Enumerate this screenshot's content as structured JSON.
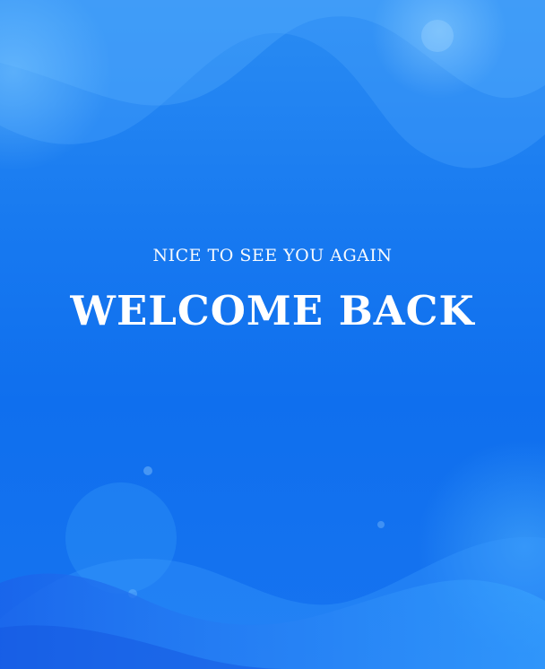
{
  "screen": {
    "subtitle": "NICE TO SEE YOU AGAIN",
    "title": "WELCOME BACK"
  },
  "colors": {
    "background": "#1779f0",
    "text": "#ffffff"
  }
}
